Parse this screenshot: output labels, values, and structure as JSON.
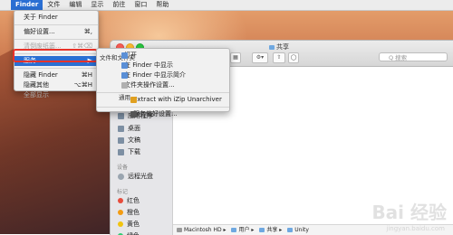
{
  "menubar": {
    "apple": "",
    "items": [
      "Finder",
      "文件",
      "编辑",
      "显示",
      "前往",
      "窗口",
      "帮助"
    ]
  },
  "finder_menu": {
    "items": [
      {
        "label": "关于 Finder",
        "shortcut": ""
      },
      {
        "label": "偏好设置...",
        "shortcut": "⌘,"
      },
      {
        "label": "清倒废纸篓...",
        "shortcut": "⇧⌘⌫"
      },
      {
        "label": "服务",
        "shortcut": "▶"
      },
      {
        "label": "隐藏 Finder",
        "shortcut": "⌘H"
      },
      {
        "label": "隐藏其他",
        "shortcut": "⌥⌘H"
      },
      {
        "label": "全部显示",
        "shortcut": ""
      }
    ]
  },
  "services_menu": {
    "cat_files": "文件和文件夹",
    "cat_general": "通用",
    "items": [
      "打开",
      "在 Finder 中显示",
      "在 Finder 中显示简介",
      "文件夹操作设置...",
      "Extract with iZip Unarchiver",
      "服务偏好设置..."
    ]
  },
  "window": {
    "title": "共享",
    "search_placeholder": "Q 搜索"
  },
  "sidebar": {
    "items": [
      "应用程序",
      "桌面",
      "文稿",
      "下载"
    ],
    "devices_header": "设备",
    "devices": [
      "远程光盘"
    ],
    "tags_header": "标记",
    "tags": [
      {
        "label": "红色",
        "color": "#e74c3c"
      },
      {
        "label": "橙色",
        "color": "#f39c12"
      },
      {
        "label": "黄色",
        "color": "#f1c40f"
      },
      {
        "label": "绿色",
        "color": "#2ecc71"
      }
    ]
  },
  "pathbar": [
    "Macintosh HD",
    "用户",
    "共享",
    "Unity"
  ],
  "watermark": {
    "main": "Bai 经验",
    "sub": "jingyan.baidu.com"
  }
}
